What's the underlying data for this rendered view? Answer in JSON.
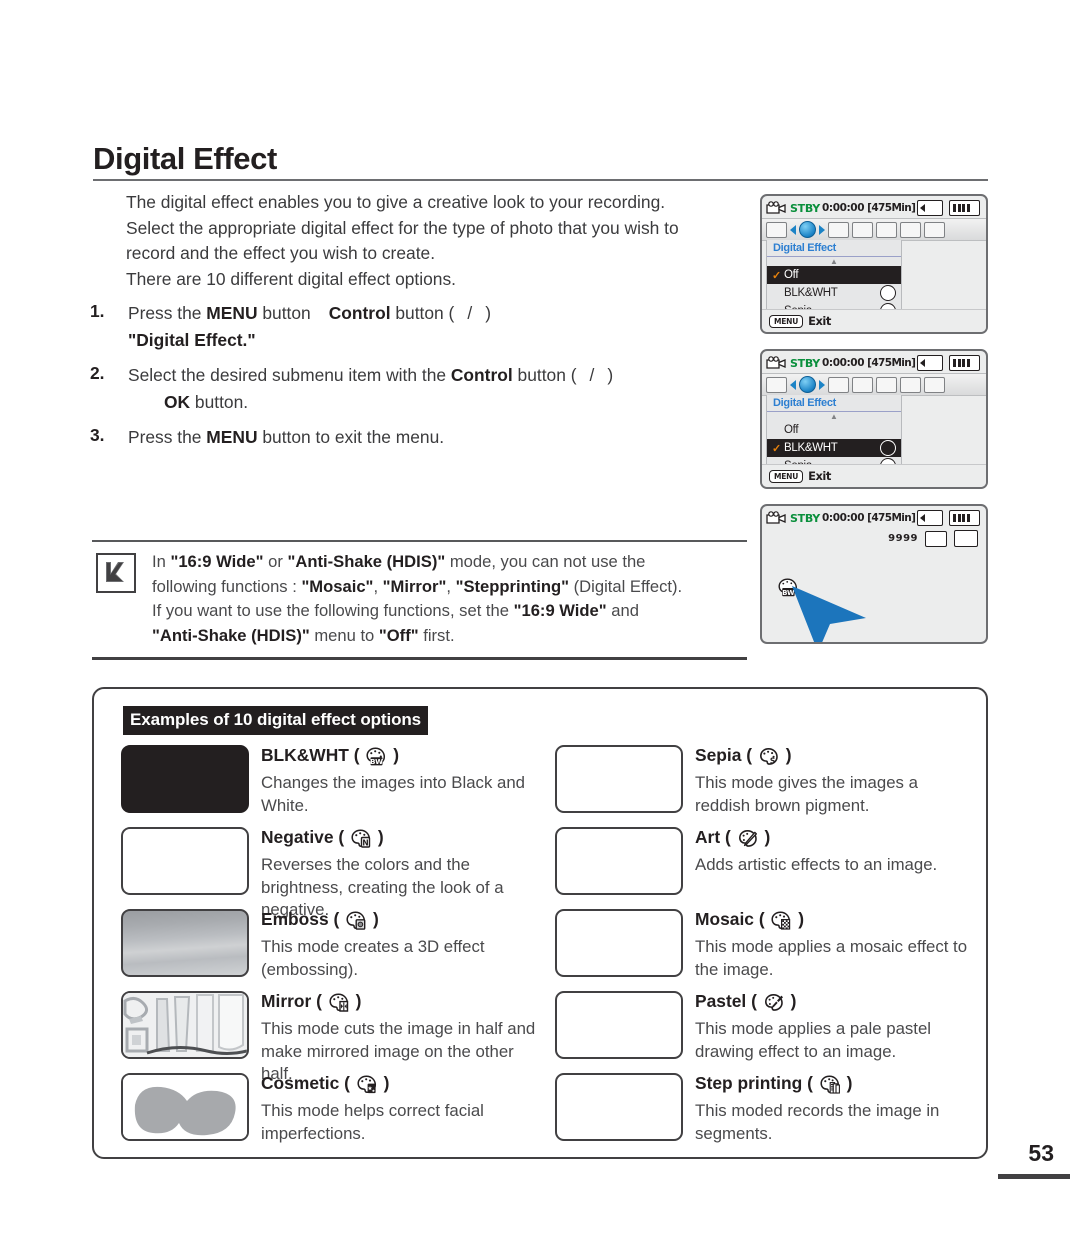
{
  "page": {
    "title": "Digital Effect",
    "number": "53"
  },
  "intro": {
    "lines": [
      "The digital effect enables you to give a creative look to your recording.",
      "Select the appropriate digital effect for the type of photo that you wish to",
      "record and the effect you wish to create.",
      "There are 10 different digital effect options."
    ]
  },
  "steps": [
    {
      "num": "1.",
      "line1_a": "Press the ",
      "line1_b": "MENU",
      "line1_c": " button",
      "line1_d": "Control",
      "line1_e": " button (",
      "line1_f": "/",
      "line1_g": ")",
      "line2": "\"Digital Effect.\""
    },
    {
      "num": "2.",
      "line1_a": "Select the desired submenu item with the ",
      "line1_b": "Control",
      "line1_c": " button (",
      "line1_d": "/",
      "line1_e": ")",
      "line2_b": "OK",
      "line2_c": " button."
    },
    {
      "num": "3.",
      "line1_a": "Press the ",
      "line1_b": "MENU",
      "line1_c": " button to exit the menu."
    }
  ],
  "note": {
    "l1_a": "In ",
    "l1_b": "\"16:9 Wide\"",
    "l1_c": " or ",
    "l1_d": "\"Anti-Shake (HDIS)\"",
    "l1_e": " mode, you can not use the",
    "l2_a": "following functions : ",
    "l2_b": "\"Mosaic\"",
    "l2_c": ", ",
    "l2_d": "\"Mirror\"",
    "l2_e": ", ",
    "l2_f": "\"Stepprinting\"",
    "l2_g": " (Digital Effect).",
    "l3_a": "If you want to use the following functions, set the ",
    "l3_b": "\"16:9 Wide\"",
    "l3_c": " and",
    "l4_a": "\"Anti-Shake (HDIS)\"",
    "l4_b": " menu to ",
    "l4_c": "\"Off\"",
    "l4_d": " first."
  },
  "examples": {
    "header": "Examples of 10 digital effect options",
    "left_column": [
      {
        "name": "BLK&WHT",
        "icon": "palette-bw-icon",
        "desc": "Changes the images into Black and White.",
        "thumb": "black"
      },
      {
        "name": "Negative",
        "icon": "palette-negative-icon",
        "desc": "Reverses the colors and the brightness, creating the look of a negative.",
        "thumb": "white"
      },
      {
        "name": "Emboss",
        "icon": "palette-emboss-icon",
        "desc": "This mode creates a 3D effect (embossing).",
        "thumb": "emboss"
      },
      {
        "name": "Mirror",
        "icon": "palette-mirror-icon",
        "desc": "This mode cuts the image in half and make mirrored image on the other half.",
        "thumb": "mirror"
      },
      {
        "name": "Cosmetic",
        "icon": "palette-cosmetic-icon",
        "desc": "This mode helps correct facial imperfections.",
        "thumb": "cosmetic"
      }
    ],
    "right_column": [
      {
        "name": "Sepia",
        "icon": "palette-sepia-icon",
        "desc": "This mode gives the images a reddish brown pigment.",
        "thumb": "white"
      },
      {
        "name": "Art",
        "icon": "palette-art-icon",
        "desc": "Adds artistic effects to an image.",
        "thumb": "white"
      },
      {
        "name": "Mosaic",
        "icon": "palette-mosaic-icon",
        "desc": "This mode applies a mosaic effect to the image.",
        "thumb": "white"
      },
      {
        "name": "Pastel",
        "icon": "palette-pastel-icon",
        "desc": "This mode applies a pale pastel drawing effect to an image.",
        "thumb": "white"
      },
      {
        "name": "Step printing",
        "icon": "palette-stepprint-icon",
        "desc": "This moded records the image in segments.",
        "thumb": "white"
      }
    ]
  },
  "lcd": {
    "status": {
      "stby": "STBY",
      "timecode": "0:00:00",
      "remaining": "[475Min]"
    },
    "menu_title": "Digital Effect",
    "items": [
      "Off",
      "BLK&WHT",
      "Sepia"
    ],
    "footer": {
      "button": "MENU",
      "label": "Exit"
    },
    "screen1_selected": "Off",
    "screen2_selected": "BLK&WHT",
    "screen3": {
      "photo_count": "9999"
    }
  },
  "colors": {
    "stby_green": "#0a8f3c",
    "menu_heading_blue": "#2d7fd1",
    "check_orange": "#e8820c",
    "cursor_blue": "#1c75bc",
    "ink": "#231f20"
  }
}
